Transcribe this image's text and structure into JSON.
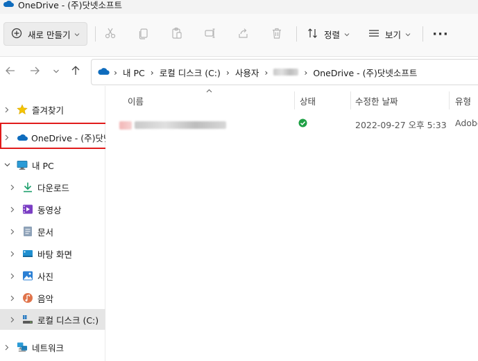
{
  "window": {
    "title": "OneDrive - (주)닷넷소프트"
  },
  "toolbar": {
    "new_label": "새로 만들기",
    "sort_label": "정렬",
    "view_label": "보기",
    "more_label": "···"
  },
  "address": {
    "crumbs": [
      "내 PC",
      "로컬 디스크 (C:)",
      "사용자",
      "OneDrive - (주)닷넷소프트"
    ]
  },
  "sidebar": {
    "items": [
      {
        "label": "즐겨찾기",
        "icon": "star-icon"
      },
      {
        "label": "OneDrive - (주)닷넷",
        "icon": "onedrive-icon"
      },
      {
        "label": "내 PC",
        "icon": "pc-icon"
      },
      {
        "label": "다운로드",
        "icon": "download-icon"
      },
      {
        "label": "동영상",
        "icon": "video-icon"
      },
      {
        "label": "문서",
        "icon": "document-icon"
      },
      {
        "label": "바탕 화면",
        "icon": "desktop-icon"
      },
      {
        "label": "사진",
        "icon": "picture-icon"
      },
      {
        "label": "음악",
        "icon": "music-icon"
      },
      {
        "label": "로컬 디스크 (C:)",
        "icon": "drive-icon"
      },
      {
        "label": "네트워크",
        "icon": "network-icon"
      }
    ]
  },
  "file_list": {
    "columns": [
      "이름",
      "상태",
      "수정한 날짜",
      "유형"
    ],
    "rows": [
      {
        "name": "",
        "status": "synced",
        "modified": "2022-09-27 오후 5:33",
        "type": "Adobe"
      }
    ]
  },
  "colors": {
    "accent": "#0f6cbd",
    "highlight": "#e11b1b",
    "status_ok": "#1fa045"
  }
}
